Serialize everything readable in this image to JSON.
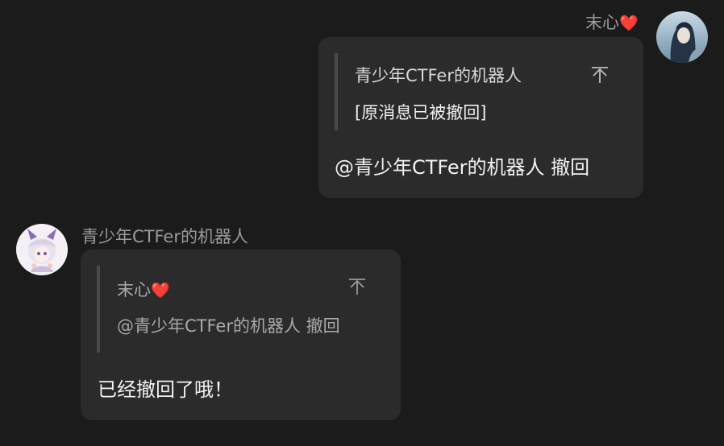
{
  "messages": [
    {
      "sender": "末心",
      "sender_emoji": "❤️",
      "side": "right",
      "quote": {
        "title": "青少年CTFer的机器人",
        "body": "[原消息已被撤回]"
      },
      "text": "@青少年CTFer的机器人 撤回"
    },
    {
      "sender": "青少年CTFer的机器人",
      "side": "left",
      "quote": {
        "title": "末心",
        "title_emoji": "❤️",
        "body": "@青少年CTFer的机器人 撤回"
      },
      "text": "已经撤回了哦！"
    }
  ],
  "icons": {
    "jump_to_quote": "arrow-up-to-line-icon"
  },
  "colors": {
    "background": "#1b1b1b",
    "bubble": "#2b2b2b",
    "quote_bar": "#4a4a4a",
    "heart": "#e0262e"
  }
}
